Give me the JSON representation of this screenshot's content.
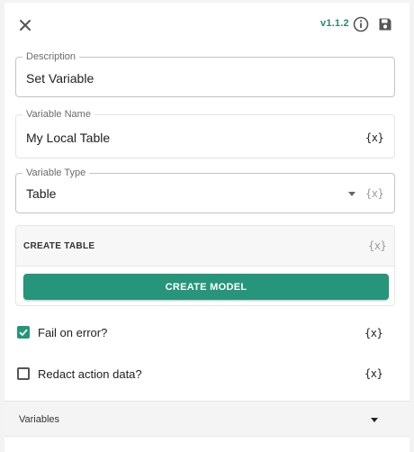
{
  "header": {
    "version": "v1.1.2",
    "close_icon": "close-icon",
    "info_icon": "info-icon",
    "save_icon": "save-icon"
  },
  "description": {
    "label": "Description",
    "value": "Set Variable"
  },
  "variable_name": {
    "label": "Variable Name",
    "value": "My Local Table",
    "var_button": "{x}"
  },
  "variable_type": {
    "label": "Variable Type",
    "value": "Table",
    "var_button": "{x}"
  },
  "create_table": {
    "title": "CREATE TABLE",
    "var_button": "{x}",
    "button_label": "CREATE MODEL"
  },
  "fail_on_error": {
    "label": "Fail on error?",
    "checked": true,
    "var_button": "{x}"
  },
  "redact": {
    "label": "Redact action data?",
    "checked": false,
    "var_button": "{x}"
  },
  "variables_section": {
    "label": "Variables"
  },
  "colors": {
    "accent": "#26957a",
    "version": "#268a6e"
  }
}
